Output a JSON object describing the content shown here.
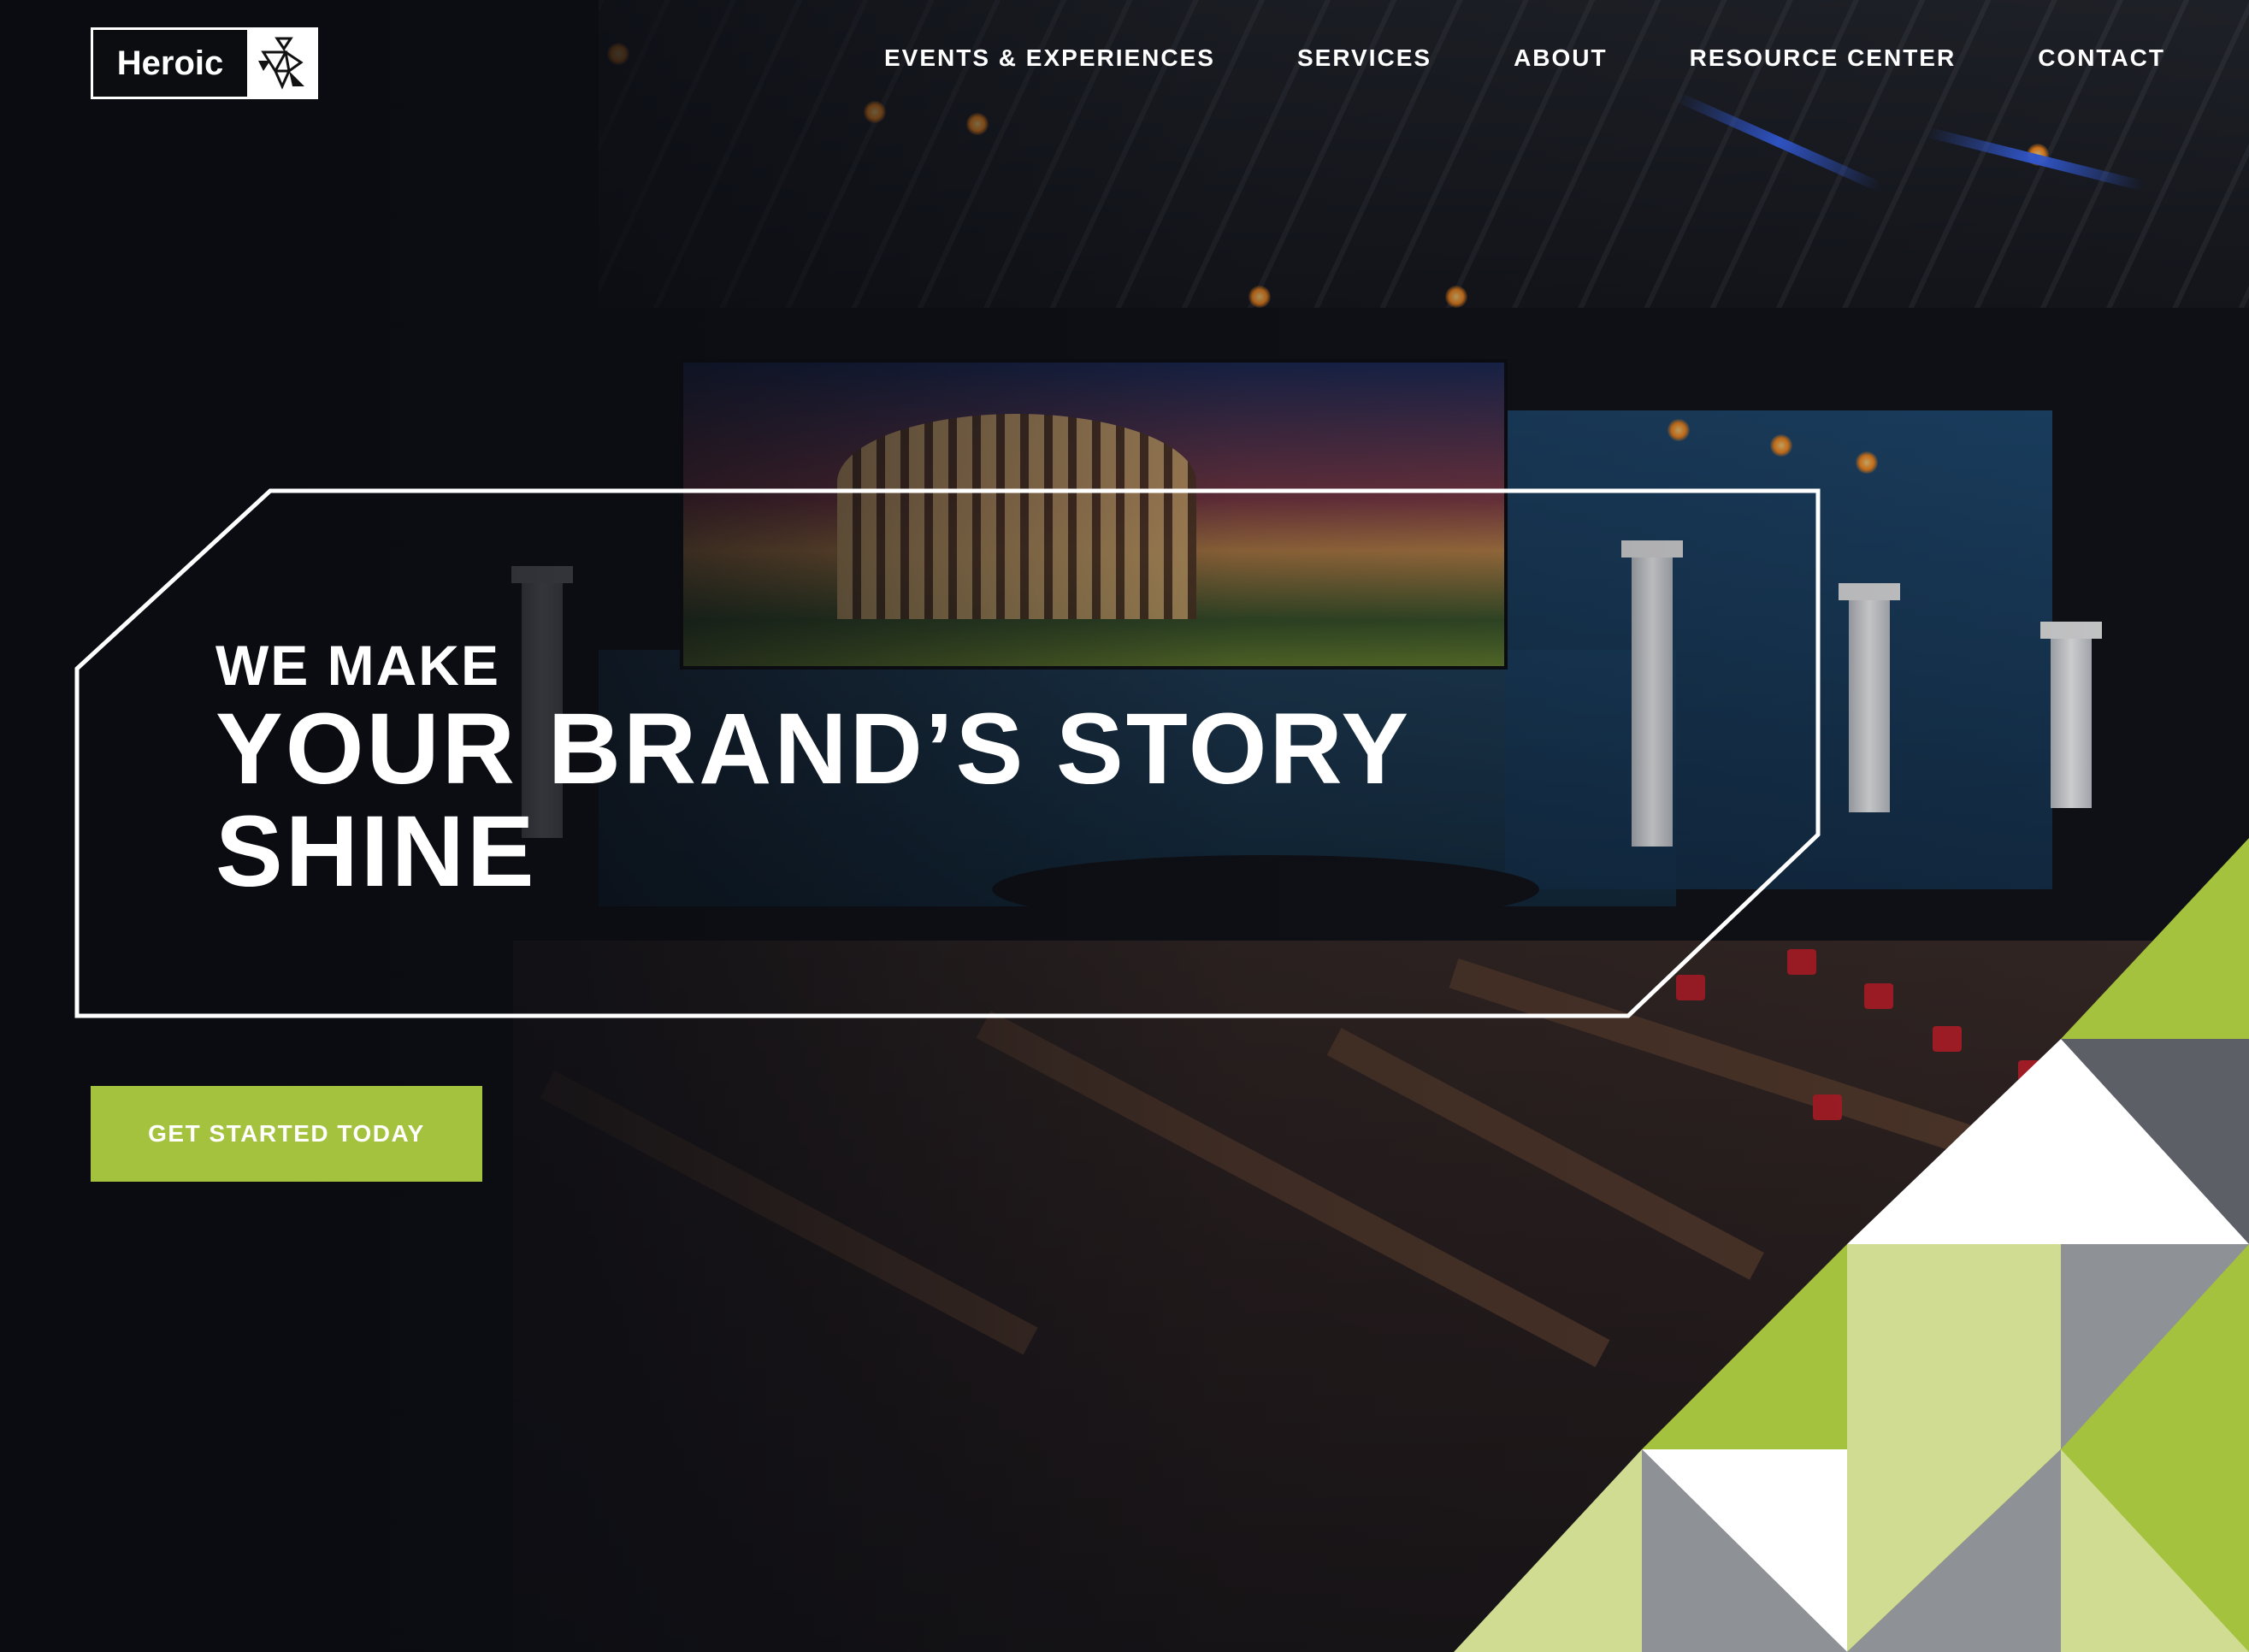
{
  "brand": {
    "name": "Heroic",
    "mark_icon": "runner-tangram-icon"
  },
  "nav": {
    "items": [
      {
        "label": "EVENTS & EXPERIENCES"
      },
      {
        "label": "SERVICES"
      },
      {
        "label": "ABOUT"
      },
      {
        "label": "RESOURCE CENTER"
      },
      {
        "label": "CONTACT"
      }
    ]
  },
  "hero": {
    "line1": "WE MAKE",
    "line2": "YOUR BRAND’S STORY",
    "line3": "SHINE",
    "cta_label": "GET STARTED TODAY"
  },
  "colors": {
    "accent_green": "#a4c23e",
    "light_green": "#cfdc92",
    "gray": "#8e9196",
    "dark_gray": "#5c6066",
    "white": "#ffffff"
  }
}
